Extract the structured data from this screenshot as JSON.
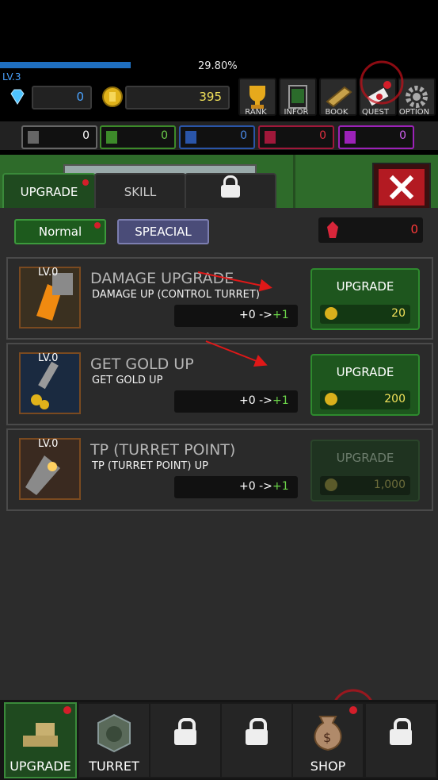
{
  "header": {
    "xp_percent_text": "29.80%",
    "xp_fraction": 0.298,
    "level": "LV.3"
  },
  "currency": {
    "gems": "0",
    "gold": "395"
  },
  "menu": [
    "RANK",
    "INFOR",
    "BOOK",
    "QUEST",
    "OPTION"
  ],
  "gem_counts": [
    {
      "value": "0",
      "color": "#666666"
    },
    {
      "value": "0",
      "color": "#3d8a2a"
    },
    {
      "value": "0",
      "color": "#2a55a8"
    },
    {
      "value": "0",
      "color": "#a0183a"
    },
    {
      "value": "0",
      "color": "#9c22b8"
    }
  ],
  "tabs": {
    "upgrade": "UPGRADE",
    "skill": "SKILL"
  },
  "filters": {
    "normal": "Normal",
    "special": "SPEACIAL",
    "ruby": "0"
  },
  "cards": [
    {
      "level": "LV.0",
      "title": "DAMAGE UPGRADE",
      "subtitle": "DAMAGE UP (CONTROL TURRET)",
      "from": "+0 ->",
      "to": "+1",
      "button": "UPGRADE",
      "cost": "20",
      "enabled": true
    },
    {
      "level": "LV.0",
      "title": "GET GOLD UP",
      "subtitle": "GET GOLD UP",
      "from": "+0 ->",
      "to": "+1",
      "button": "UPGRADE",
      "cost": "200",
      "enabled": true
    },
    {
      "level": "LV.0",
      "title": "TP (TURRET POINT)",
      "subtitle": "TP (TURRET POINT) UP",
      "from": "+0 ->",
      "to": "+1",
      "button": "UPGRADE",
      "cost": "1,000",
      "enabled": false
    }
  ],
  "bottom_nav": {
    "upgrade": "UPGRADE",
    "turret": "TURRET",
    "shop": "SHOP"
  }
}
